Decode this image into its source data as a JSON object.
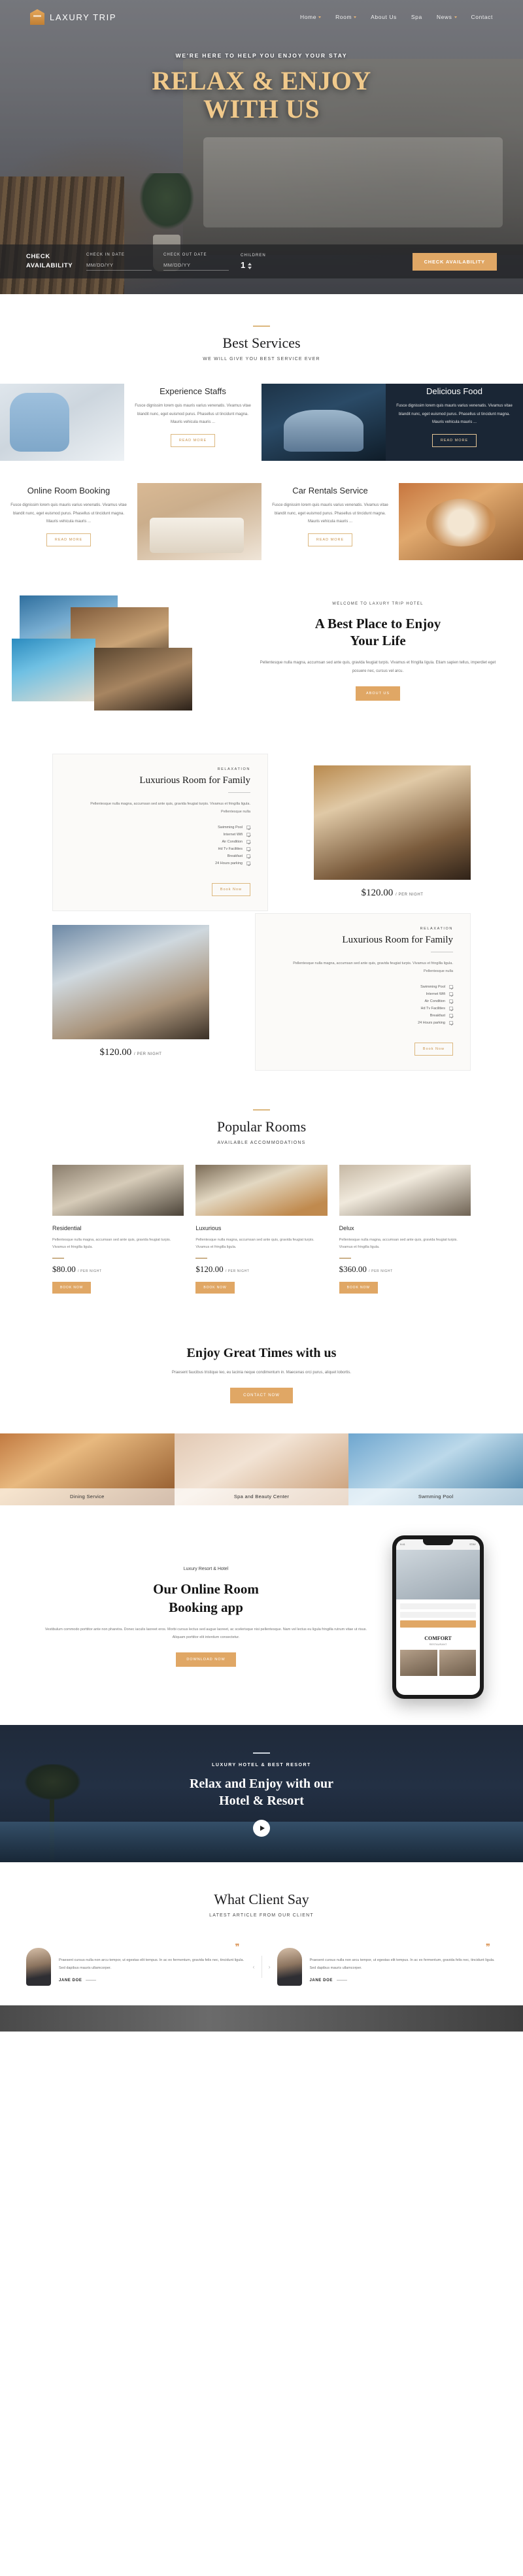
{
  "header": {
    "brand": "LAXURY TRIP",
    "nav": [
      {
        "label": "Home",
        "caret": true
      },
      {
        "label": "Room",
        "caret": true
      },
      {
        "label": "About Us",
        "caret": false
      },
      {
        "label": "Spa",
        "caret": false
      },
      {
        "label": "News",
        "caret": true
      },
      {
        "label": "Contact",
        "caret": false
      }
    ]
  },
  "hero": {
    "eyebrow": "WE'RE HERE TO HELP YOU ENJOY YOUR STAY",
    "title_line1": "RELAX & ENJOY",
    "title_line2": "WITH US",
    "booking": {
      "label_line1": "CHECK",
      "label_line2": "AVAILABILITY",
      "checkin_label": "CHECK IN DATE",
      "checkin_placeholder": "MM/DD/YY",
      "checkout_label": "CHECK OUT DATE",
      "checkout_placeholder": "MM/DD/YY",
      "children_label": "CHILDREN",
      "children_value": "1",
      "button": "CHECK AVAILABILITY"
    }
  },
  "services": {
    "title": "Best Services",
    "subtitle": "WE WILL GIVE YOU BEST SERVICE EVER",
    "items": [
      {
        "name": "Experience Staffs",
        "body": "Fusce dignissim lorem quis mauris varius venenatis. Vivamus vitae blandit nunc, eget euismod purus. Phasellus ut tincidunt magna. Mauris vehicula mauris ...",
        "button": "READ MORE"
      },
      {
        "name": "Delicious Food",
        "body": "Fusce dignissim lorem quis mauris varius venenatis. Vivamus vitae blandit nunc, eget euismod purus. Phasellus ut tincidunt magna. Mauris vehicula mauris ...",
        "button": "READ MORE"
      },
      {
        "name": "Online Room Booking",
        "body": "Fusce dignissim lorem quis mauris varius venenatis. Vivamus vitae blandit nunc, eget euismod purus. Phasellus ut tincidunt magna. Mauris vehicula mauris ...",
        "button": "READ MORE"
      },
      {
        "name": "Car Rentals Service",
        "body": "Fusce dignissim lorem quis mauris varius venenatis. Vivamus vitae blandit nunc, eget euismod purus. Phasellus ut tincidunt magna. Mauris vehicula mauris ...",
        "button": "READ MORE"
      }
    ]
  },
  "about": {
    "eyebrow": "WELCOME TO LAXURY TRIP HOTEL",
    "title_line1": "A Best Place to Enjoy",
    "title_line2": "Your Life",
    "body": "Pellentesque nulla magna, accumsan sed ante quis, gravida feugiat turpis. Vivamus et fringilla ligula. Etiam sapien tellus, imperdiet eget posuere nec, cursus vel arcu.",
    "button": "ABOUT US"
  },
  "room_feature": {
    "eyebrow": "RELAXATION",
    "title": "Luxurious Room for Family",
    "body": "Pellentesque nulla magna, accumsan sed ante quis, gravida feugiat turpis. Vivamus et fringilla ligula. Pellentesque nulla",
    "amenities": [
      "Swimming Pool",
      "Internet Wifi",
      "Air Condition",
      "Hd Tv Facilities",
      "Breakfast",
      "24 Hours parking"
    ],
    "button": "Book Now",
    "price": "$120.00",
    "price_unit": "/ PER NIGHT"
  },
  "popular": {
    "title": "Popular Rooms",
    "subtitle": "AVAILABLE ACCOMMODATIONS",
    "rooms": [
      {
        "name": "Residential",
        "body": "Pellentesque nulla magna, accumsan sed ante quis, gravida feugiat turpis. Vivamus et fringilla ligula.",
        "price": "$80.00",
        "price_unit": "/ PER NIGHT",
        "button": "BOOK NOW"
      },
      {
        "name": "Luxurious",
        "body": "Pellentesque nulla magna, accumsan sed ante quis, gravida feugiat turpis. Vivamus et fringilla ligula.",
        "price": "$120.00",
        "price_unit": "/ PER NIGHT",
        "button": "BOOK NOW"
      },
      {
        "name": "Delux",
        "body": "Pellentesque nulla magna, accumsan sed ante quis, gravida feugiat turpis. Vivamus et fringilla ligula.",
        "price": "$360.00",
        "price_unit": "/ PER NIGHT",
        "button": "BOOK NOW"
      }
    ]
  },
  "cta": {
    "title": "Enjoy Great Times with us",
    "body": "Praesent faucibus tristique leo, eu lacinia neque condimentum in. Maecenas orci purus, aliquet lobortis.",
    "button": "CONTACT NOW"
  },
  "gallery": {
    "items": [
      {
        "label": "Dining Service"
      },
      {
        "label": "Spa and Beauty Center"
      },
      {
        "label": "Swmming Pool"
      }
    ]
  },
  "app": {
    "eyebrow": "Luxury Resort & Hotel",
    "title_line1": "Our Online Room",
    "title_line2": "Booking app",
    "body": "Vestibulum commodo porttitor ante non pharetra. Donec iaculis laoreet eros. Morbi cursus lectus sed augue laoreet, ac scelerisque nisi pellentesque. Nam vel lectus eu ligula fringilla rutrum vitae ut risus. Aliquam porttitor elit interdum consectetur.",
    "button": "DOWNLOAD NOW",
    "phone": {
      "status_time": "9:41",
      "status_right": "STAY",
      "form_button": "BOOK NOW",
      "headline": "COMFORT",
      "sub": "RESTAURANT"
    }
  },
  "video_banner": {
    "eyebrow": "LUXURY HOTEL & BEST RESORT",
    "title_line1": "Relax and Enjoy with our",
    "title_line2": "Hotel & Resort"
  },
  "testimonials": {
    "title": "What Client Say",
    "subtitle": "LATEST ARTICLE FROM OUR CLIENT",
    "items": [
      {
        "quote": "Praesent cursus nulla non arcu tempor, ut egestas elit tempus. In ac ex fermentum, gravida felis nec, tincidunt ligula. Sed dapibus mauris ullamcorper.",
        "name": "JANE DOE"
      },
      {
        "quote": "Praesent cursus nulla non arcu tempor, ut egestas elit tempus. In ac ex fermentum, gravida felis nec, tincidunt ligula. Sed dapibus mauris ullamcorper.",
        "name": "JANE DOE"
      }
    ],
    "prev": "‹",
    "next": "›"
  },
  "colors": {
    "accent": "#e0a765",
    "gold": "#dcb77e",
    "dark": "#1a2635"
  }
}
